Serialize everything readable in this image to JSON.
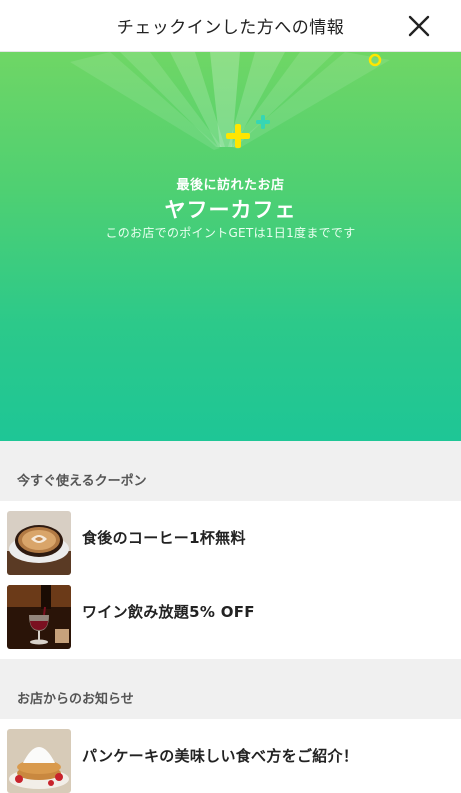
{
  "header": {
    "title": "チェックインした方への情報"
  },
  "hero": {
    "subtitle": "最後に訪れたお店",
    "shop_name": "ヤフーカフェ",
    "note": "このお店でのポイントGETは1日1度までです"
  },
  "coupons": {
    "section_title": "今すぐ使えるクーポン",
    "items": [
      {
        "label": "食後のコーヒー1杯無料",
        "thumbnail": "coffee-latte"
      },
      {
        "label": "ワイン飲み放題5% OFF",
        "thumbnail": "wine-glass"
      }
    ]
  },
  "news": {
    "section_title": "お店からのお知らせ",
    "items": [
      {
        "label": "パンケーキの美味しい食べ方をご紹介！",
        "thumbnail": "pancake"
      }
    ]
  },
  "colors": {
    "hero_top": "#6fd665",
    "hero_bottom": "#1ec696",
    "sparkle_yellow": "#ffe600",
    "sparkle_teal": "#36d6b4"
  }
}
